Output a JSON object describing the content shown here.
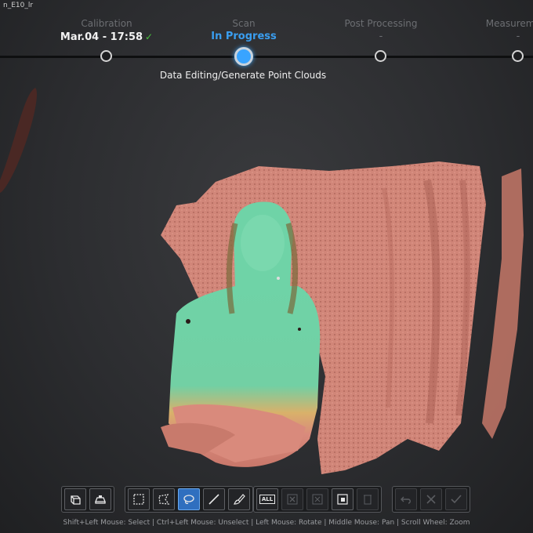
{
  "project": {
    "name": "n_E10_lr"
  },
  "workflow": {
    "steps": [
      {
        "name": "Calibration",
        "status": "Mar.04 - 17:58",
        "check": "✓"
      },
      {
        "name": "Scan",
        "status": "In Progress"
      },
      {
        "name": "Post Processing",
        "status": "-"
      },
      {
        "name": "Measurement",
        "status": "-"
      }
    ],
    "current_substep": "Data Editing/Generate Point Clouds"
  },
  "toolbar": {
    "select_all_label": "ALL"
  },
  "hint_text": "Shift+Left Mouse: Select | Ctrl+Left Mouse: Unselect | Left Mouse: Rotate | Middle Mouse: Pan | Scroll Wheel: Zoom",
  "colors": {
    "accent": "#3a9ef0",
    "check": "#48c23d",
    "point_cloud_background": "#d98a7c",
    "point_cloud_subject": "#6fd3a7",
    "point_cloud_warm": "#d9b16a"
  },
  "icons": [
    "view-cube-icon",
    "layers-icon",
    "rect-select-icon",
    "polygon-select-icon",
    "lasso-select-icon",
    "line-select-icon",
    "brush-select-icon",
    "select-all-icon",
    "delete-icon",
    "crop-icon",
    "isolate-icon",
    "trash-icon",
    "undo-icon",
    "cancel-icon",
    "confirm-icon"
  ]
}
